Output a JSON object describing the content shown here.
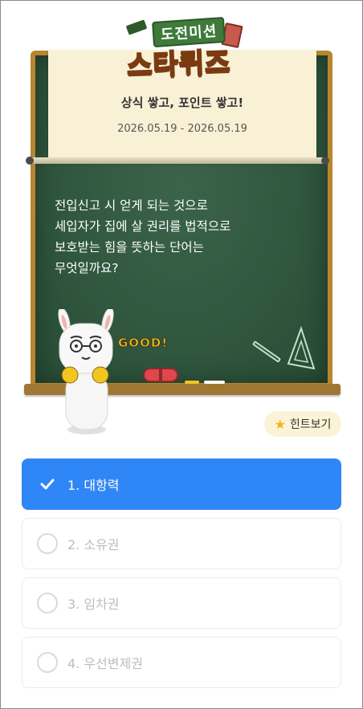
{
  "header": {
    "logo_top": "도전미션",
    "logo_main": "스타퀴즈",
    "subtitle": "상식 쌓고, 포인트 쌓고!",
    "date_range": "2026.05.19 - 2026.05.19"
  },
  "question": {
    "text": "전입신고 시 얻게 되는 것으로\n세입자가 집에 살 권리를 법적으로\n보호받는 힘을 뜻하는 단어는\n무엇일까요?"
  },
  "decor": {
    "good_text": "GOOD!"
  },
  "hint": {
    "label": "힌트보기",
    "icon": "star-icon"
  },
  "options": [
    {
      "label": "1. 대항력",
      "selected": true
    },
    {
      "label": "2. 소유권",
      "selected": false
    },
    {
      "label": "3. 임차권",
      "selected": false
    },
    {
      "label": "4. 우선변제권",
      "selected": false
    }
  ],
  "colors": {
    "selected": "#2f86f6",
    "board": "#2f5a3f",
    "board_frame": "#b8862f",
    "hint_bg": "#fbf3d6"
  }
}
